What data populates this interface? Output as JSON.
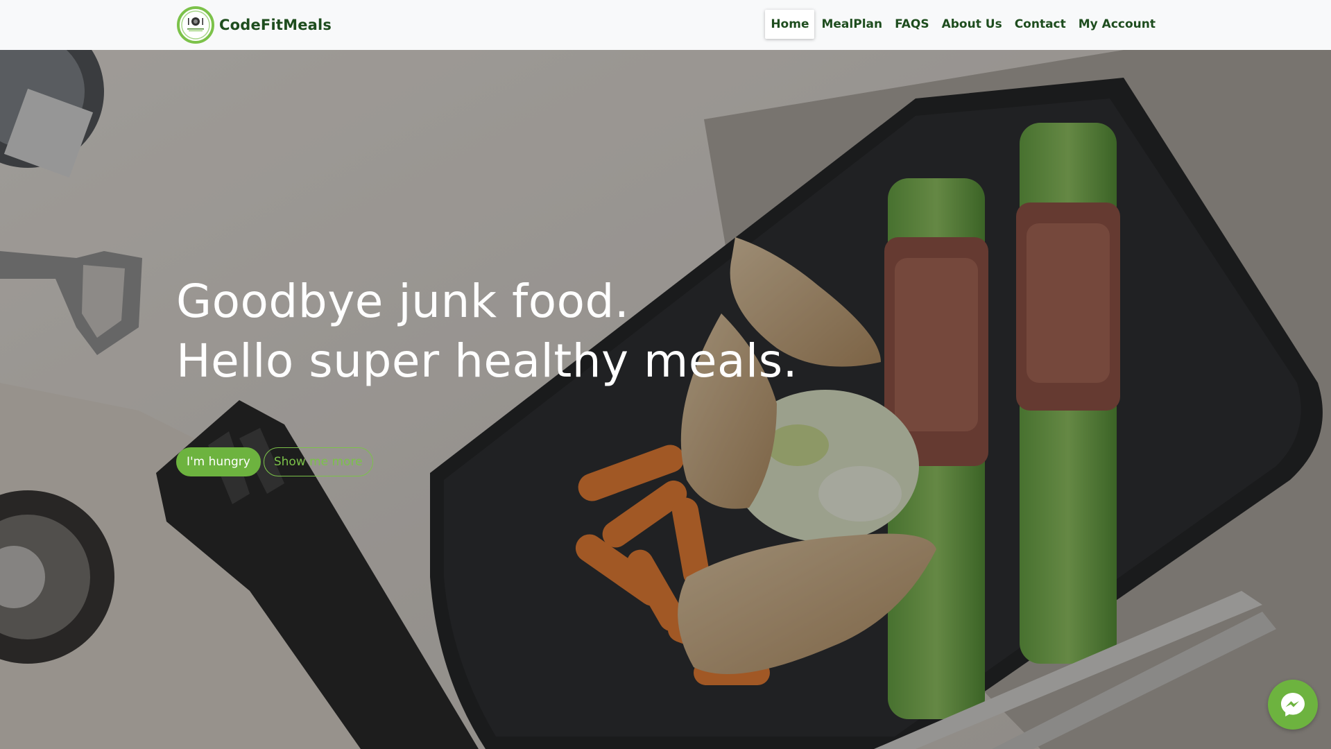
{
  "brand": {
    "name": "CodeFitMeals",
    "logo_icon": "plate-fork-logo-icon",
    "color": "#1e4d1e"
  },
  "nav": {
    "items": [
      {
        "label": "Home",
        "active": true
      },
      {
        "label": "MealPlan",
        "active": false
      },
      {
        "label": "FAQS",
        "active": false
      },
      {
        "label": "About Us",
        "active": false
      },
      {
        "label": "Contact",
        "active": false
      },
      {
        "label": "My Account",
        "active": false
      }
    ]
  },
  "hero": {
    "line1": "Goodbye junk food.",
    "line2": "Hello super healthy meals.",
    "primary_button": "I'm hungry",
    "secondary_button": "Show me more",
    "background_image": "plate of grilled chicken, baby carrots, leeks and prosciutto-wrapped asparagus on a black tray"
  },
  "chat": {
    "icon": "messenger-icon"
  },
  "colors": {
    "accent": "#6db33f",
    "nav_text": "#1e4d1e",
    "navbar_bg": "#f8f9fa"
  }
}
